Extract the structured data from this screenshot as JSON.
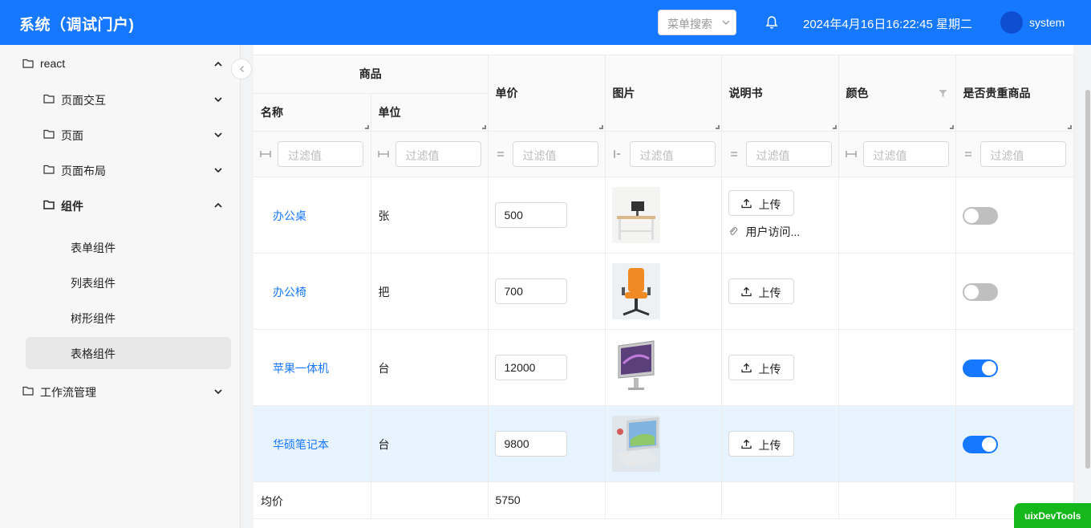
{
  "header": {
    "brand": "系统（调试门户)",
    "menu_search_placeholder": "菜单搜索",
    "datetime": "2024年4月16日16:22:45 星期二",
    "username": "system",
    "accent_color": "#1677ff"
  },
  "sidebar": {
    "items": [
      {
        "label": "react",
        "level": 0,
        "folder": true,
        "expanded": true
      },
      {
        "label": "页面交互",
        "level": 1,
        "folder": true,
        "expanded": false
      },
      {
        "label": "页面",
        "level": 1,
        "folder": true,
        "expanded": false
      },
      {
        "label": "页面布局",
        "level": 1,
        "folder": true,
        "expanded": false
      },
      {
        "label": "组件",
        "level": 1,
        "folder": true,
        "expanded": true
      },
      {
        "label": "表单组件",
        "level": 2,
        "folder": false
      },
      {
        "label": "列表组件",
        "level": 2,
        "folder": false
      },
      {
        "label": "树形组件",
        "level": 2,
        "folder": false
      },
      {
        "label": "表格组件",
        "level": 2,
        "folder": false,
        "selected": true
      },
      {
        "label": "工作流管理",
        "level": 0,
        "folder": true,
        "expanded": false
      }
    ]
  },
  "table": {
    "group_header": "商品",
    "columns": [
      "名称",
      "单位",
      "单价",
      "图片",
      "说明书",
      "颜色",
      "是否贵重商品"
    ],
    "filter_placeholder": "过滤值",
    "filter_operators": [
      "between-icon",
      "between-icon",
      "equals-icon",
      "starts-with-icon",
      "equals-icon",
      "between-icon",
      "equals-icon"
    ],
    "upload_label": "上传",
    "rows": [
      {
        "name": "办公桌",
        "unit": "张",
        "price": "500",
        "image": "desk-image",
        "file": "用户访问...",
        "valuable": false
      },
      {
        "name": "办公椅",
        "unit": "把",
        "price": "700",
        "image": "chair-image",
        "file": "",
        "valuable": false
      },
      {
        "name": "苹果一体机",
        "unit": "台",
        "price": "12000",
        "image": "imac-image",
        "file": "",
        "valuable": true
      },
      {
        "name": "华硕笔记本",
        "unit": "台",
        "price": "9800",
        "image": "laptop-image",
        "file": "",
        "valuable": true
      }
    ],
    "summary": {
      "label": "均价",
      "price": "5750"
    }
  },
  "devtools": {
    "label": "uixDevTools"
  }
}
